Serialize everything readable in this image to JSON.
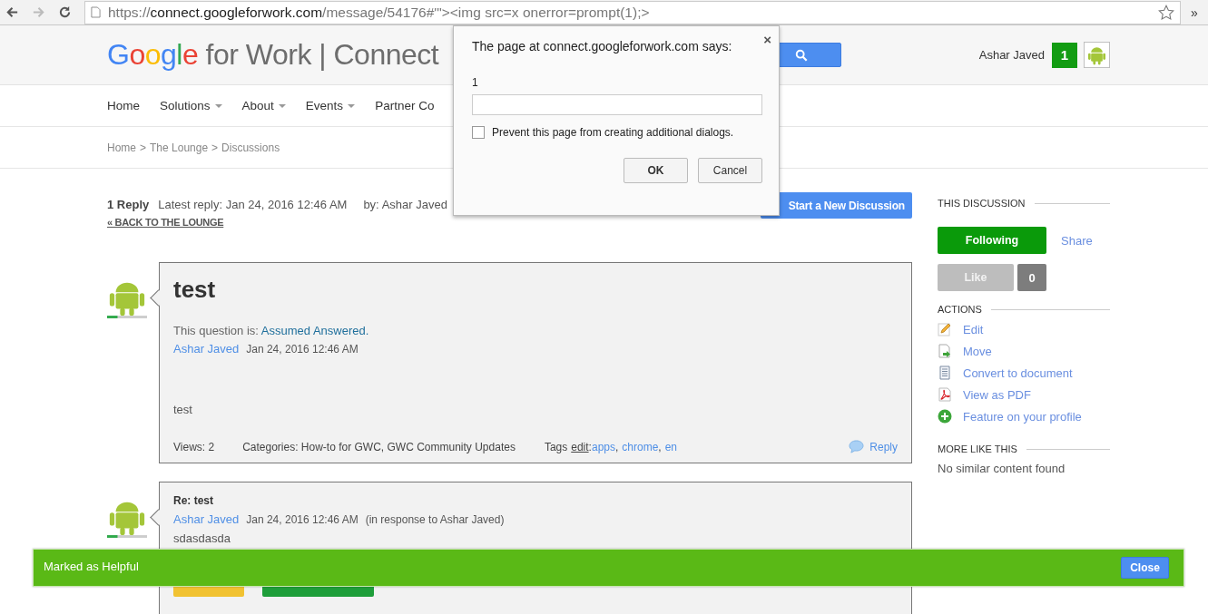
{
  "browser": {
    "url_scheme": "https://",
    "url_host": "connect.googleforwork.com",
    "url_path": "/message/54176#'\"><img src=x onerror=prompt(1);>",
    "forward_disabled": true,
    "overflow": "»"
  },
  "header": {
    "logo_google": "Google",
    "logo_rest": "for Work | Connect",
    "user": "Ashar Javed",
    "notification_count": "1"
  },
  "nav": [
    {
      "label": "Home",
      "dropdown": false
    },
    {
      "label": "Solutions",
      "dropdown": true
    },
    {
      "label": "About",
      "dropdown": true
    },
    {
      "label": "Events",
      "dropdown": true
    },
    {
      "label": "Partner Co",
      "dropdown": false
    }
  ],
  "breadcrumb": {
    "separator": ">",
    "items": [
      "Home",
      "The Lounge",
      "Discussions"
    ]
  },
  "summary": {
    "replies": "1 Reply",
    "latest": "Latest reply: Jan 24, 2016 12:46 AM",
    "by": "by: Ashar Javed",
    "back_link": "« BACK TO THE LOUNGE",
    "new_button": "Start a New Discussion"
  },
  "posts": [
    {
      "kind": "question",
      "title": "test",
      "status_label": "This question is:",
      "status": "Assumed Answered.",
      "author": "Ashar Javed",
      "date": "Jan 24, 2016 12:46 AM",
      "body": "test",
      "views": "Views: 2",
      "categories": "Categories: How-to for GWC, GWC Community Updates",
      "tags_label": "Tags",
      "tags_edit": "edit",
      "tags_colon": ":",
      "tag_separator": ",",
      "tags": [
        "apps",
        "chrome",
        "en"
      ],
      "reply": "Reply"
    },
    {
      "kind": "reply",
      "title": "Re: test",
      "author": "Ashar Javed",
      "date": "Jan 24, 2016 12:46 AM",
      "in_response": "(in response to Ashar Javed)",
      "body": "sdasdasda"
    }
  ],
  "sidebar": {
    "discussion_heading": "THIS DISCUSSION",
    "follow": {
      "label": "Following",
      "following": true
    },
    "share": "Share",
    "like": {
      "label": "Like",
      "disabled": true,
      "count": "0"
    },
    "actions_heading": "ACTIONS",
    "actions": [
      {
        "kind": "edit",
        "label": "Edit"
      },
      {
        "kind": "move",
        "label": "Move"
      },
      {
        "kind": "document",
        "label": "Convert to document"
      },
      {
        "kind": "pdf",
        "label": "View as PDF"
      },
      {
        "kind": "feature",
        "label": "Feature on your profile"
      }
    ],
    "more_heading": "MORE LIKE THIS",
    "more_text": "No similar content found"
  },
  "dialog": {
    "title": "The page at connect.googleforwork.com says:",
    "message": "1",
    "checkbox": {
      "label": "Prevent this page from creating additional dialogs.",
      "checked": false
    },
    "ok": "OK",
    "cancel": "Cancel",
    "close": "×"
  },
  "toast": {
    "message": "Marked as Helpful",
    "close": "Close"
  }
}
